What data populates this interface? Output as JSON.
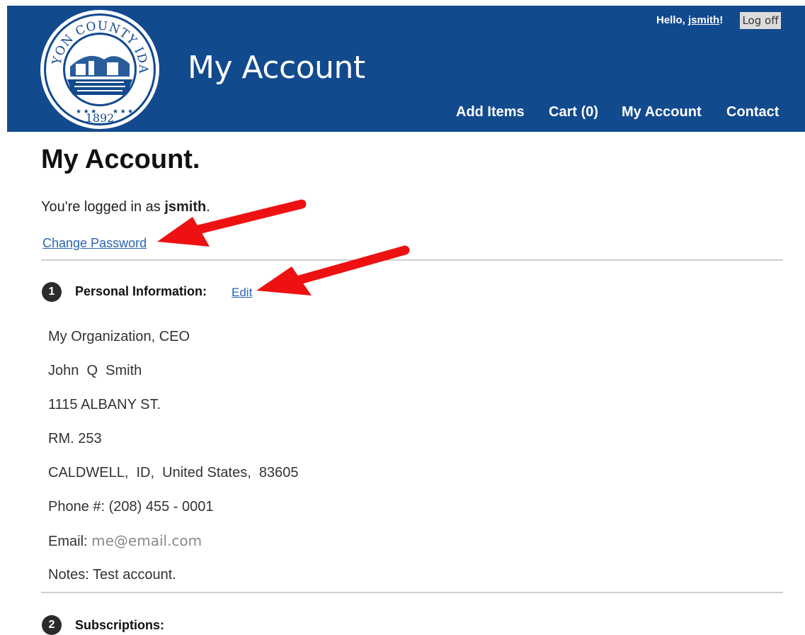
{
  "header": {
    "seal": {
      "top_text": "CANYON COUNTY IDAHO",
      "year": "1892"
    },
    "site_title": "My Account",
    "greeting_prefix": "Hello, ",
    "username": "jsmith",
    "greeting_suffix": "!",
    "logoff_label": "Log off",
    "nav": [
      {
        "label": "Add Items"
      },
      {
        "label": "Cart (0)"
      },
      {
        "label": "My Account"
      },
      {
        "label": "Contact"
      }
    ]
  },
  "main": {
    "heading": "My Account.",
    "logged_in_prefix": "You're logged in as ",
    "logged_in_user": "jsmith",
    "logged_in_suffix": ".",
    "change_password_label": "Change Password",
    "sections": [
      {
        "number": "1",
        "title": "Personal Information:",
        "edit_label": "Edit"
      },
      {
        "number": "2",
        "title": "Subscriptions:"
      }
    ],
    "personal_info": {
      "organization": "My Organization, CEO",
      "name": "John  Q  Smith",
      "address1": "1115 ALBANY ST.",
      "address2": "RM. 253",
      "city_line": "CALDWELL,  ID,  United States,  83605",
      "phone": "Phone #: (208) 455 - 0001",
      "email_label": "Email: ",
      "email": "me@email.com",
      "notes": "Notes: Test account."
    }
  },
  "colors": {
    "header_bg": "#124a8e",
    "link": "#2a64b0",
    "annotation_arrow": "#ee1111"
  }
}
